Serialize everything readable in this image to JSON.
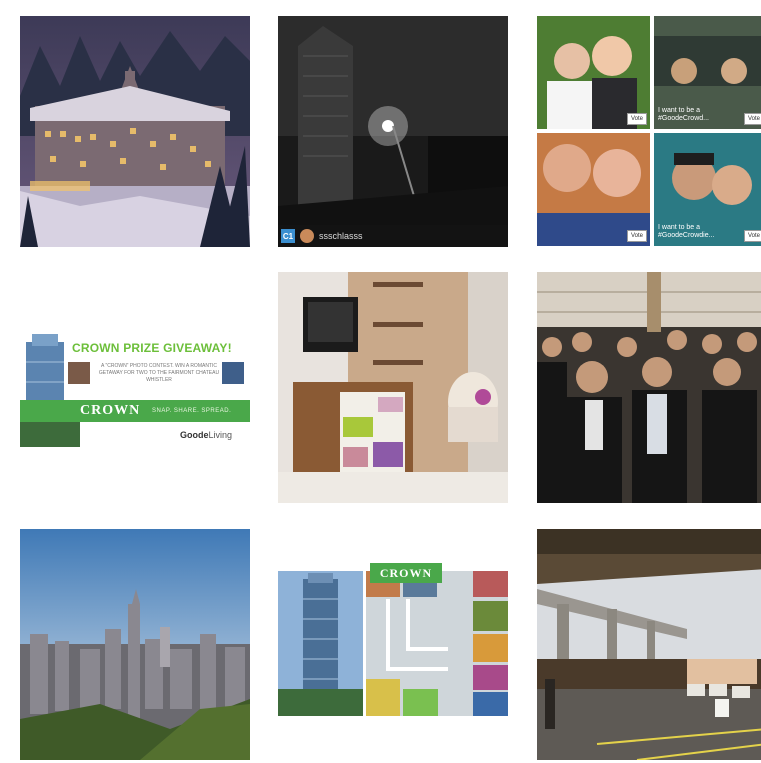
{
  "gallery": {
    "tiles": [
      {
        "subject": "snowy castle hotel at dusk"
      },
      {
        "subject": "black and white high-rise tower",
        "username": "ssschlasss",
        "badge": "C1"
      },
      {
        "subject": "photo collage of couples",
        "captions": [
          "I want to be a #GoodeCrowd...",
          "I want to be a #GoodeCrowdie..."
        ],
        "vote_label": "Vote"
      },
      {
        "subject": "Crown prize giveaway ad",
        "title": "CROWN PRIZE GIVEAWAY!",
        "subtitle": "A \"CROWN\" PHOTO CONTEST. WIN A ROMANTIC GETAWAY FOR TWO TO THE FAIRMONT CHATEAU WHISTLER",
        "brand_word": "CROWN",
        "tagline": "SNAP. SHARE. SPREAD.",
        "logo_bold": "Goode",
        "logo_rest": "Living"
      },
      {
        "subject": "colourful living room interior"
      },
      {
        "subject": "crowd of people in dark suits"
      },
      {
        "subject": "city skyline with tall tower"
      },
      {
        "subject": "Crown tower collage",
        "sign": "CROWN"
      },
      {
        "subject": "concrete overpass and parking lot"
      }
    ]
  },
  "colors": {
    "accent_green": "#4aa84a",
    "title_green": "#6cbf3a"
  }
}
